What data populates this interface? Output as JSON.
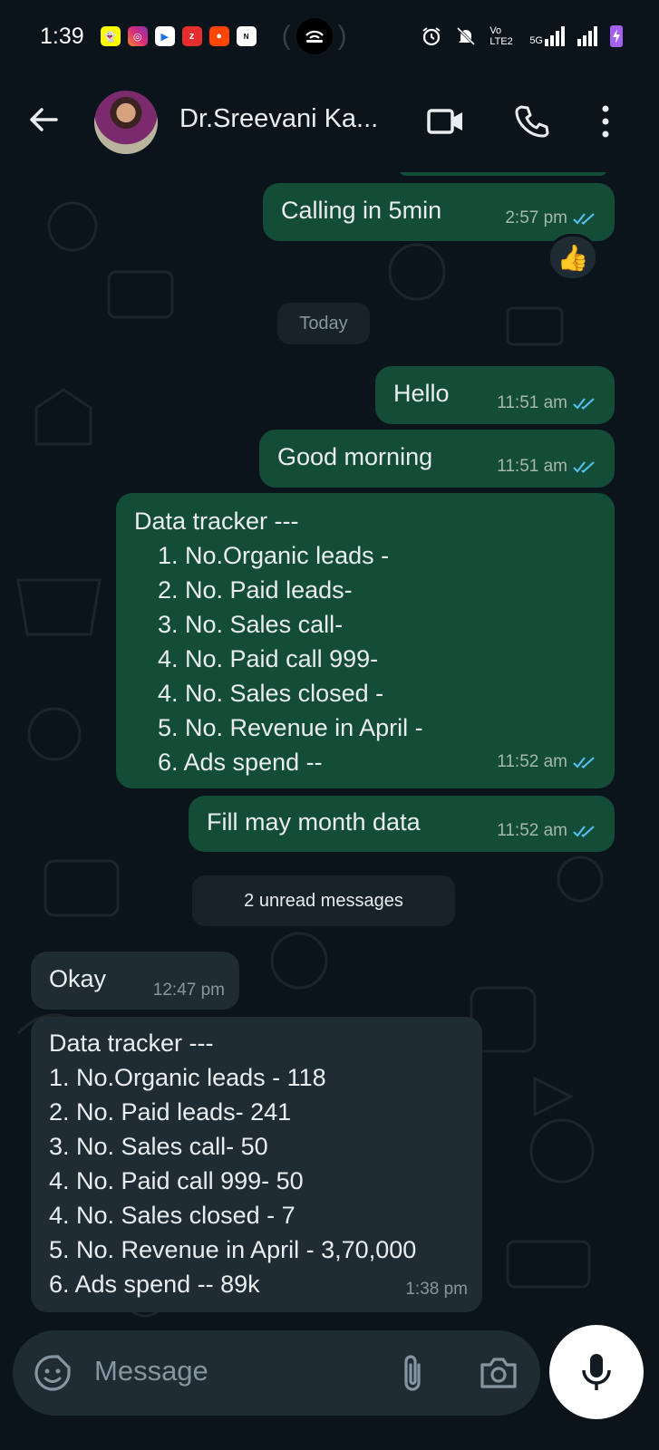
{
  "status_bar": {
    "time": "1:39",
    "network_label": "Vo LTE2",
    "net_type": "5G"
  },
  "header": {
    "contact_name": "Dr.Sreevani Ka..."
  },
  "chat": {
    "messages": [
      {
        "text": "Calling in 5min",
        "time": "2:57 pm",
        "reaction": "👍"
      },
      {
        "text": "Hello",
        "time": "11:51 am"
      },
      {
        "text": "Good morning",
        "time": "11:51 am"
      },
      {
        "title": "Data tracker ---",
        "lines": [
          "1. No.Organic leads -",
          "2. No. Paid leads-",
          "3. No. Sales call-",
          "4. No. Paid call 999-",
          "4. No. Sales closed -",
          "5. No. Revenue in April -",
          "6. Ads spend --"
        ],
        "time": "11:52 am"
      },
      {
        "text": "Fill may month data",
        "time": "11:52 am"
      },
      {
        "text": "Okay",
        "time": "12:47 pm"
      },
      {
        "title": "Data tracker ---",
        "lines": [
          "1. No.Organic leads - 118",
          "2. No. Paid leads- 241",
          "3. No. Sales call- 50",
          "4. No. Paid call 999- 50",
          "4. No. Sales closed - 7",
          "5. No. Revenue in April - 3,70,000",
          "6. Ads spend -- 89k"
        ],
        "time": "1:38 pm"
      }
    ],
    "date_chip": "Today",
    "unread_chip": "2 unread messages"
  },
  "composer": {
    "placeholder": "Message"
  },
  "colors": {
    "background": "#0b141a",
    "outgoing_bubble": "#144d37",
    "incoming_bubble": "#202c33",
    "read_ticks": "#53bdeb"
  }
}
